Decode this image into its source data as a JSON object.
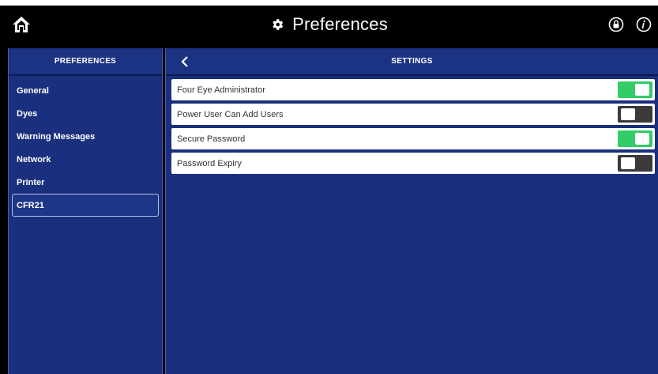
{
  "caption": "",
  "header": {
    "title": "Preferences",
    "title_icon": "gear-icon",
    "home_icon": "home-icon",
    "lock_icon": "lock-icon",
    "info_icon": "info-icon"
  },
  "sidebar": {
    "title": "PREFERENCES",
    "items": [
      {
        "label": "General",
        "selected": false
      },
      {
        "label": "Dyes",
        "selected": false
      },
      {
        "label": "Warning Messages",
        "selected": false
      },
      {
        "label": "Network",
        "selected": false
      },
      {
        "label": "Printer",
        "selected": false
      },
      {
        "label": "CFR21",
        "selected": true
      }
    ]
  },
  "settings": {
    "title": "SETTINGS",
    "back_icon": "chevron-left-icon",
    "rows": [
      {
        "label": "Four Eye Administrator",
        "enabled": true
      },
      {
        "label": "Power User Can Add Users",
        "enabled": false
      },
      {
        "label": "Secure Password",
        "enabled": true
      },
      {
        "label": "Password Expiry",
        "enabled": false
      }
    ]
  },
  "colors": {
    "topbar": "#000000",
    "panel": "#1a2f7d",
    "toggle_on": "#33cc66",
    "toggle_off": "#3a3a3a"
  }
}
